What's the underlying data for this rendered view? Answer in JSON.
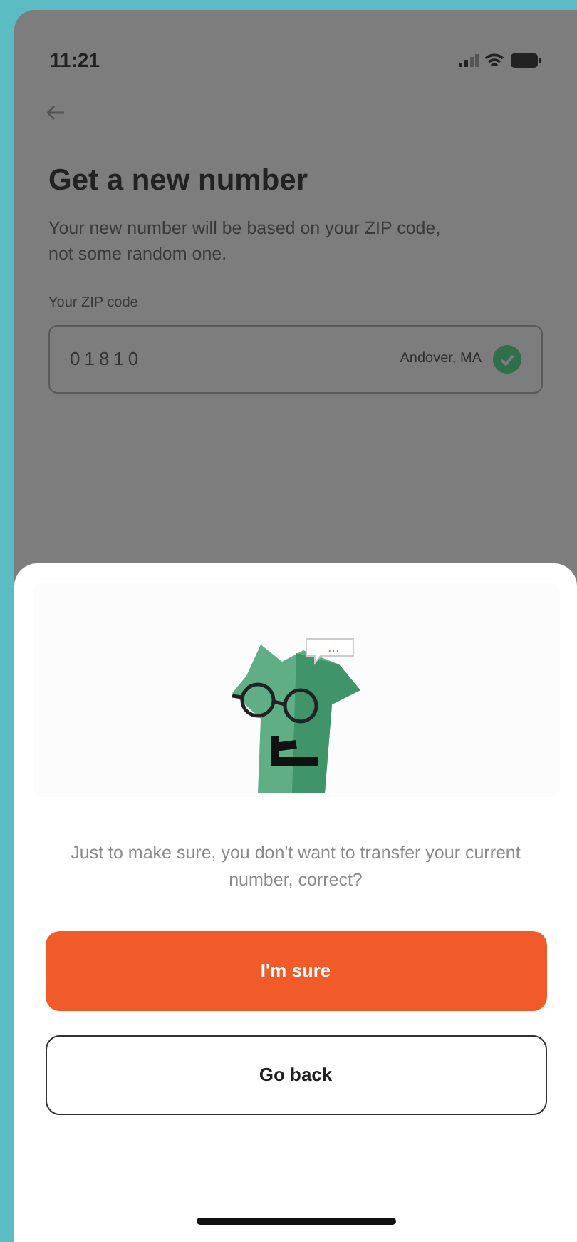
{
  "status_bar": {
    "time": "11:21"
  },
  "page": {
    "title": "Get a new number",
    "subtitle": "Your new number will be based on your ZIP code, not some random one.",
    "zip_field": {
      "label": "Your ZIP code",
      "value": "01810",
      "location": "Andover, MA",
      "valid": true
    }
  },
  "sheet": {
    "speech_bubble": "...",
    "message": "Just to make sure, you don't want to transfer your current number, correct?",
    "buttons": [
      {
        "label": "I'm sure",
        "kind": "primary"
      },
      {
        "label": "Go back",
        "kind": "secondary"
      }
    ]
  }
}
